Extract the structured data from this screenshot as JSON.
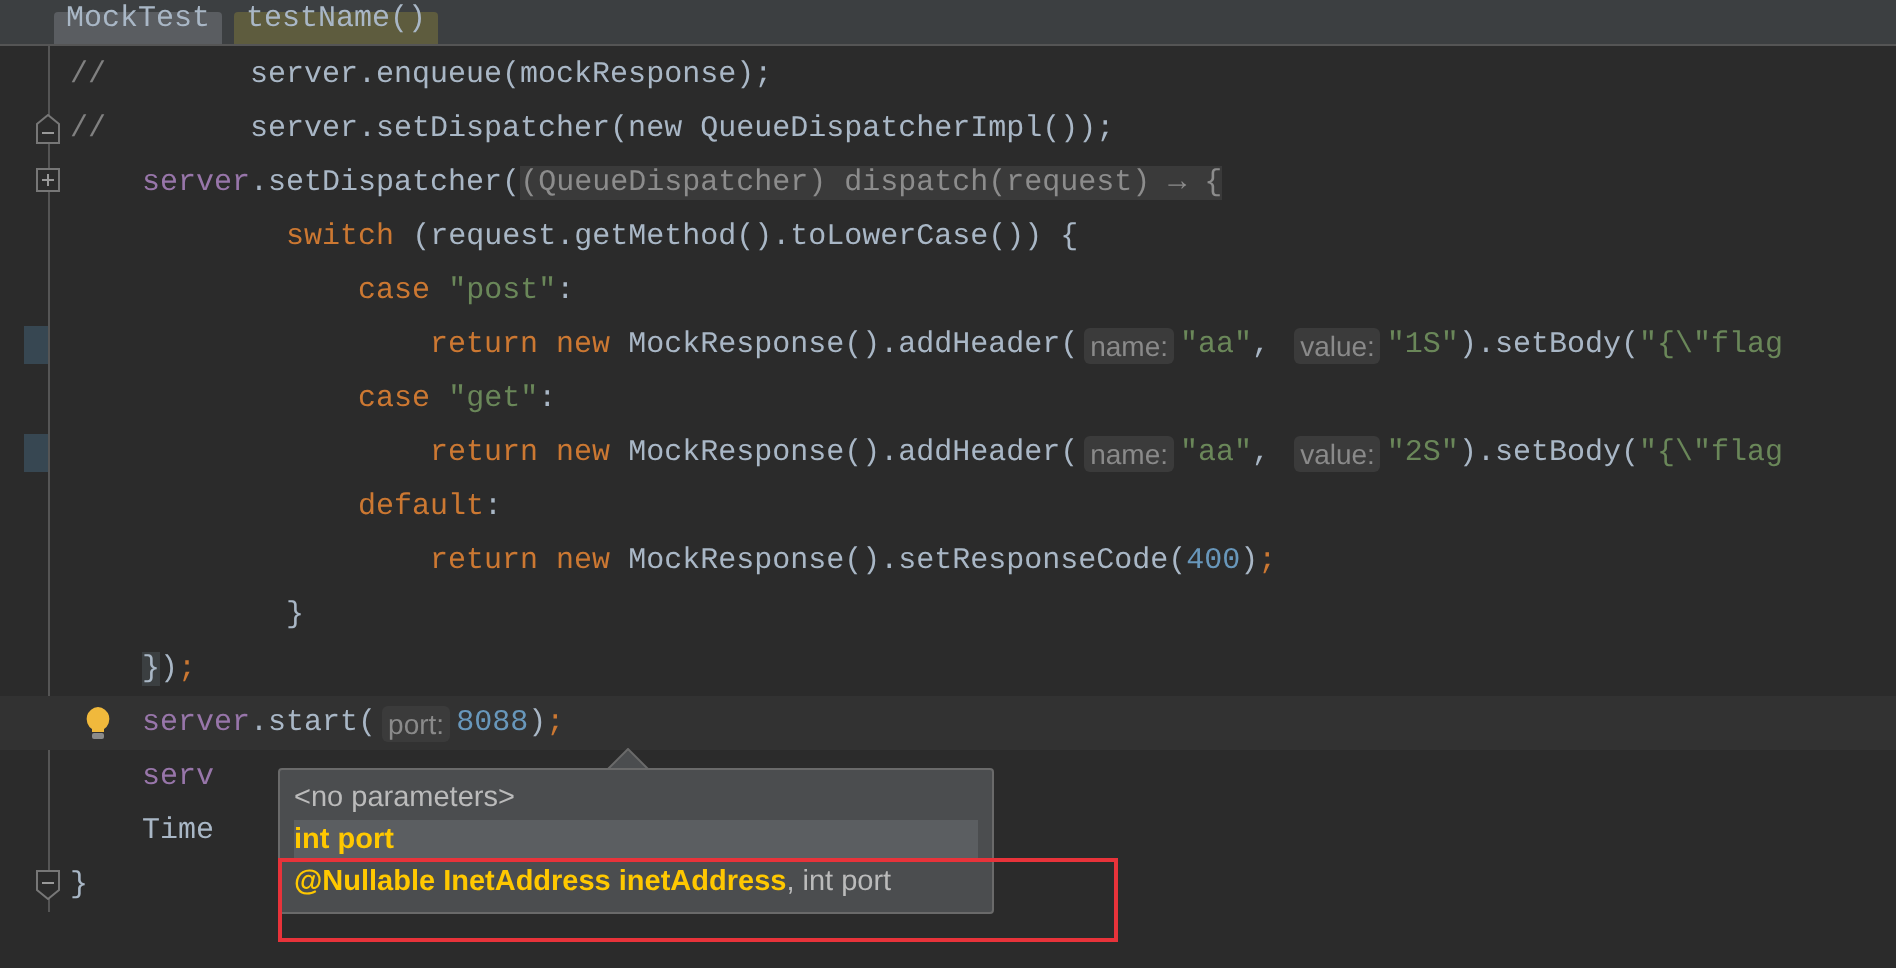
{
  "breadcrumbs": [
    {
      "label": "MockTest",
      "kind": "class"
    },
    {
      "label": "testName()",
      "kind": "method"
    }
  ],
  "lines": [
    {
      "kind": "none",
      "current": false,
      "tokens": [
        {
          "kind": "comment",
          "text": "//"
        },
        {
          "kind": "plain",
          "text": "        server.enqueue(mockResponse);"
        }
      ]
    },
    {
      "kind": "fold-start",
      "current": false,
      "tokens": [
        {
          "kind": "comment",
          "text": "//"
        },
        {
          "kind": "plain",
          "text": "        server.setDispatcher(new QueueDispatcherImpl());"
        }
      ]
    },
    {
      "kind": "fold-collapsed",
      "current": false,
      "tokens": [
        {
          "kind": "field",
          "text": "    server"
        },
        {
          "kind": "plain",
          "text": ".setDispatcher("
        },
        {
          "kind": "folded",
          "text": "(QueueDispatcher) dispatch(request) → {"
        }
      ]
    },
    {
      "kind": "none",
      "current": false,
      "tokens": [
        {
          "kind": "keyword",
          "text": "            switch"
        },
        {
          "kind": "plain",
          "text": " (request.getMethod().toLowerCase()) {"
        }
      ]
    },
    {
      "kind": "none",
      "current": false,
      "tokens": [
        {
          "kind": "keyword",
          "text": "                case"
        },
        {
          "kind": "string",
          "text": " \"post\""
        },
        {
          "kind": "plain",
          "text": ":"
        }
      ]
    },
    {
      "kind": "change",
      "current": false,
      "tokens": [
        {
          "kind": "keyword",
          "text": "                    return new"
        },
        {
          "kind": "plain",
          "text": " MockResponse().addHeader("
        },
        {
          "kind": "hint",
          "text": "name:"
        },
        {
          "kind": "string",
          "text": "\"aa\""
        },
        {
          "kind": "plain",
          "text": ", "
        },
        {
          "kind": "hint",
          "text": "value:"
        },
        {
          "kind": "string",
          "text": "\"1S\""
        },
        {
          "kind": "plain",
          "text": ").setBody("
        },
        {
          "kind": "string",
          "text": "\"{\\\"flag"
        }
      ]
    },
    {
      "kind": "none",
      "current": false,
      "tokens": [
        {
          "kind": "keyword",
          "text": "                case"
        },
        {
          "kind": "string",
          "text": " \"get\""
        },
        {
          "kind": "plain",
          "text": ":"
        }
      ]
    },
    {
      "kind": "change",
      "current": false,
      "tokens": [
        {
          "kind": "keyword",
          "text": "                    return new"
        },
        {
          "kind": "plain",
          "text": " MockResponse().addHeader("
        },
        {
          "kind": "hint",
          "text": "name:"
        },
        {
          "kind": "string",
          "text": "\"aa\""
        },
        {
          "kind": "plain",
          "text": ", "
        },
        {
          "kind": "hint",
          "text": "value:"
        },
        {
          "kind": "string",
          "text": "\"2S\""
        },
        {
          "kind": "plain",
          "text": ").setBody("
        },
        {
          "kind": "string",
          "text": "\"{\\\"flag"
        }
      ]
    },
    {
      "kind": "none",
      "current": false,
      "tokens": [
        {
          "kind": "keyword",
          "text": "                default"
        },
        {
          "kind": "plain",
          "text": ":"
        }
      ]
    },
    {
      "kind": "none",
      "current": false,
      "tokens": [
        {
          "kind": "keyword",
          "text": "                    return new"
        },
        {
          "kind": "plain",
          "text": " MockResponse().setResponseCode("
        },
        {
          "kind": "number",
          "text": "400"
        },
        {
          "kind": "plain",
          "text": ")"
        },
        {
          "kind": "keyword",
          "text": ";"
        }
      ]
    },
    {
      "kind": "none",
      "current": false,
      "tokens": [
        {
          "kind": "plain",
          "text": "            }"
        }
      ]
    },
    {
      "kind": "none",
      "current": false,
      "tokens": [
        {
          "kind": "brace-match",
          "text": "    }"
        },
        {
          "kind": "plain",
          "text": ")"
        },
        {
          "kind": "keyword",
          "text": ";"
        }
      ]
    },
    {
      "kind": "bulb",
      "current": true,
      "tokens": [
        {
          "kind": "field",
          "text": "    server"
        },
        {
          "kind": "plain",
          "text": ".start("
        },
        {
          "kind": "hint",
          "text": "port:"
        },
        {
          "kind": "number",
          "text": "8088"
        },
        {
          "kind": "plain",
          "text": ")"
        },
        {
          "kind": "keyword",
          "text": ";"
        }
      ]
    },
    {
      "kind": "none",
      "current": false,
      "tokens": [
        {
          "kind": "field",
          "text": "    serv"
        }
      ]
    },
    {
      "kind": "none",
      "current": false,
      "tokens": [
        {
          "kind": "plain",
          "text": "    Time"
        }
      ]
    },
    {
      "kind": "fold-end",
      "current": false,
      "tokens": [
        {
          "kind": "plain",
          "text": "}"
        }
      ]
    }
  ],
  "popup": {
    "items": [
      {
        "text": "<no parameters>",
        "selected": false
      },
      {
        "text": "**int port**",
        "selected": true
      },
      {
        "text": "**@Nullable InetAddress inetAddress**, int port",
        "selected": false
      }
    ]
  }
}
